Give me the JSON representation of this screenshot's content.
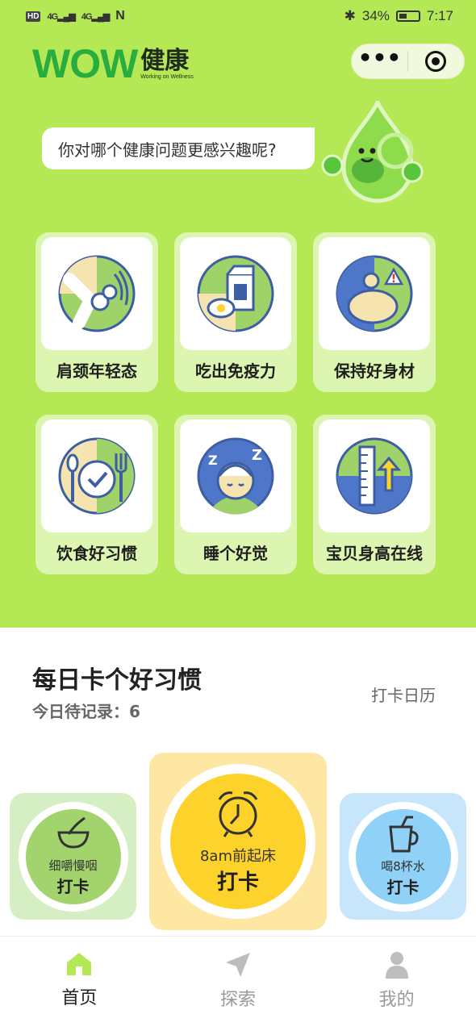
{
  "status_bar": {
    "hd": "HD",
    "sig1": "4G",
    "sig2": "4G",
    "nfc": "N",
    "battery": "34%",
    "time": "7:17"
  },
  "header": {
    "logo_text": "WOW",
    "logo_cn": "健康",
    "logo_sub": "Working on Wellness",
    "more": "•••"
  },
  "bubble": {
    "question": "你对哪个健康问题更感兴趣呢?"
  },
  "topics": [
    {
      "label": "肩颈年轻态",
      "icon": "shoulder-joint-icon"
    },
    {
      "label": "吃出免疫力",
      "icon": "milk-egg-icon"
    },
    {
      "label": "保持好身材",
      "icon": "belly-warning-icon"
    },
    {
      "label": "饮食好习惯",
      "icon": "plate-cutlery-icon"
    },
    {
      "label": "睡个好觉",
      "icon": "sleeping-face-icon"
    },
    {
      "label": "宝贝身高在线",
      "icon": "height-ruler-icon"
    }
  ],
  "habits": {
    "title": "每日卡个好习惯",
    "pending": "今日待记录：6",
    "calendar": "打卡日历",
    "items": [
      {
        "name": "细嚼慢咽",
        "action": "打卡",
        "icon": "bowl-icon"
      },
      {
        "name": "8am前起床",
        "action": "打卡",
        "icon": "alarm-clock-icon"
      },
      {
        "name": "喝8杯水",
        "action": "打卡",
        "icon": "cup-icon"
      }
    ]
  },
  "nav": [
    {
      "label": "首页",
      "icon": "home-icon",
      "active": true
    },
    {
      "label": "探索",
      "icon": "explore-icon",
      "active": false
    },
    {
      "label": "我的",
      "icon": "profile-icon",
      "active": false
    }
  ],
  "colors": {
    "background": "#b5e855",
    "card": "#dcf5b0",
    "brand_green": "#28ad3e",
    "alarm_yellow": "#fcd22b",
    "water_blue": "#8fd1f7"
  }
}
